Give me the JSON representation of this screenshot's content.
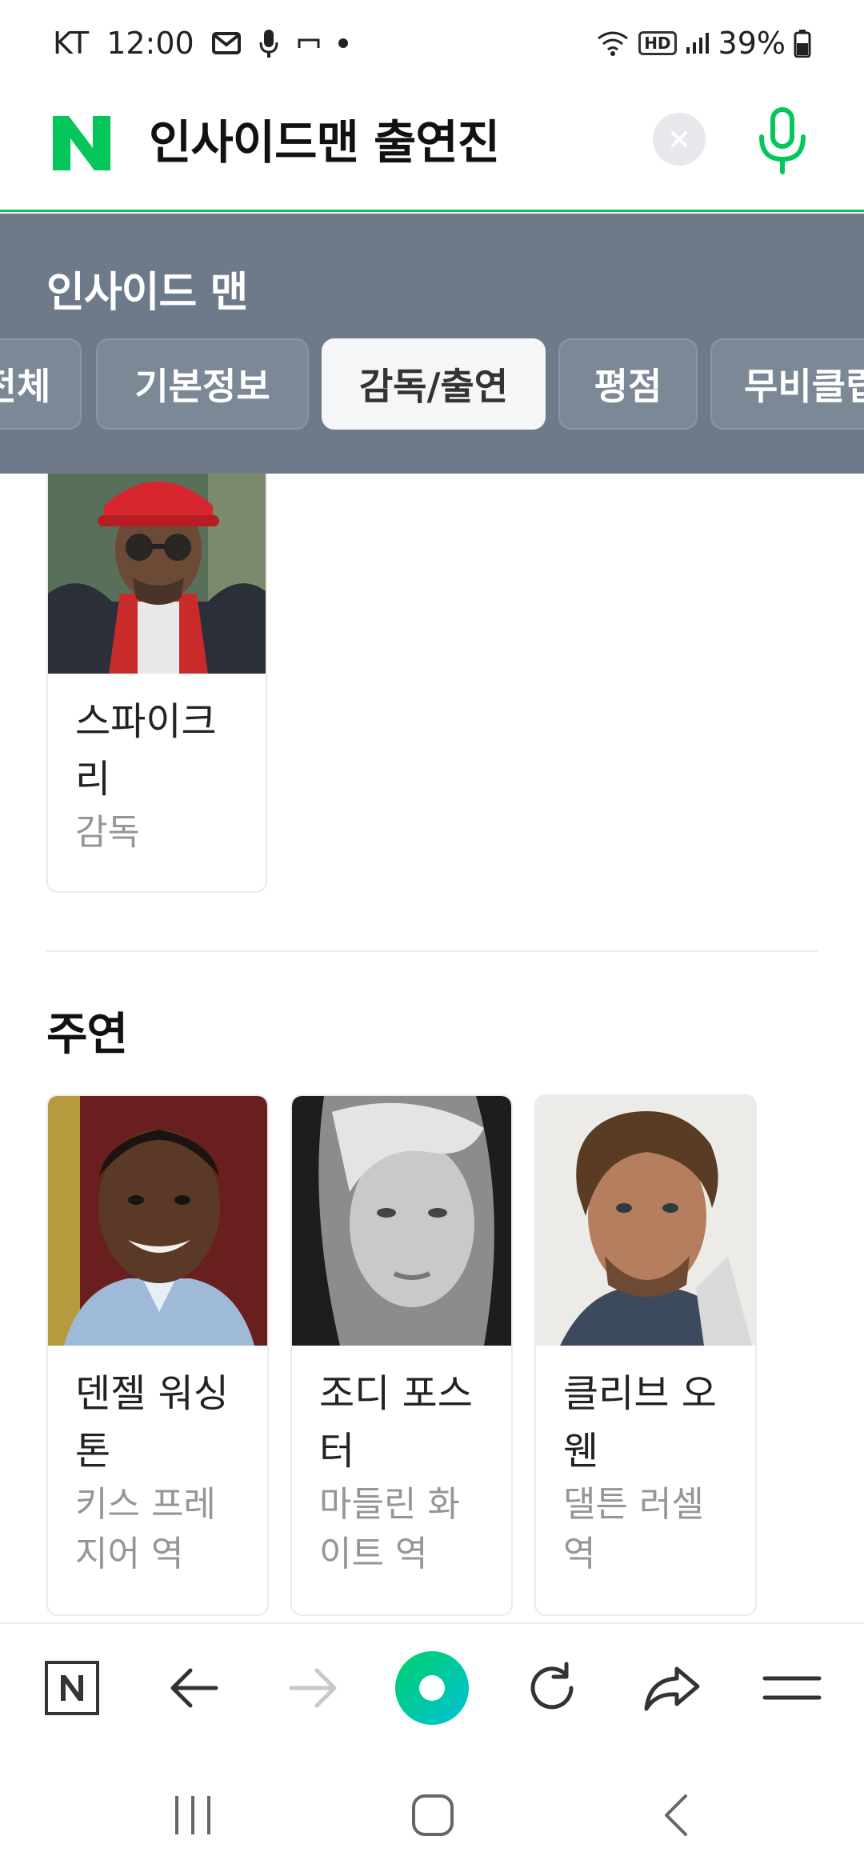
{
  "status_bar": {
    "carrier": "KT",
    "time": "12:00",
    "battery": "39%",
    "hd_label": "HD",
    "icons": [
      "mail-icon",
      "mic-icon",
      "voicemail-icon",
      "dot-icon",
      "wifi-icon",
      "hd-icon",
      "signal-icon",
      "battery-icon"
    ]
  },
  "search": {
    "logo": "N",
    "query": "인사이드맨 출연진"
  },
  "movie": {
    "title": "인사이드 맨",
    "tabs": [
      {
        "label": "전체",
        "active": false
      },
      {
        "label": "기본정보",
        "active": false
      },
      {
        "label": "감독/출연",
        "active": true
      },
      {
        "label": "평점",
        "active": false
      },
      {
        "label": "무비클립",
        "active": false
      }
    ]
  },
  "director": {
    "name": "스파이크 리",
    "role": "감독"
  },
  "cast_section": {
    "title": "주연",
    "cast": [
      {
        "name": "덴젤 워싱톤",
        "role": "키스 프레지어 역"
      },
      {
        "name": "조디 포스터",
        "role": "마들린 화이트 역"
      },
      {
        "name": "클리브 오웬",
        "role": "댈튼 러셀 역"
      }
    ]
  },
  "toolbar": {
    "icons": [
      "naver-home-icon",
      "back-arrow-icon",
      "forward-arrow-icon",
      "green-dot-icon",
      "refresh-icon",
      "share-icon",
      "menu-icon"
    ],
    "accent_color": "#03c75a"
  },
  "nav_bar": {
    "icons": [
      "recent-apps-icon",
      "home-icon",
      "back-icon"
    ]
  }
}
